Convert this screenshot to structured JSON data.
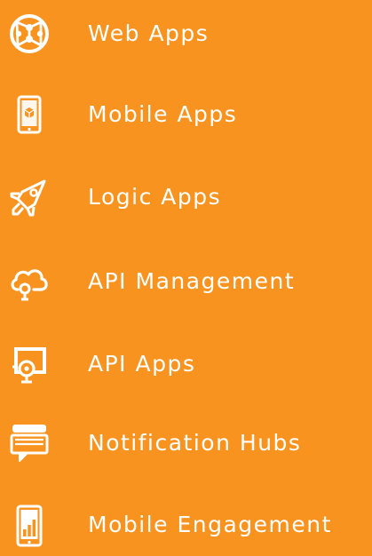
{
  "menu": {
    "background_color": "#F7931E",
    "foreground_color": "#FFFFFF",
    "items": [
      {
        "label": "Web Apps",
        "icon": "globe-network-icon"
      },
      {
        "label": "Mobile Apps",
        "icon": "mobile-device-icon"
      },
      {
        "label": "Logic Apps",
        "icon": "rocket-icon"
      },
      {
        "label": "API Management",
        "icon": "cloud-gear-icon"
      },
      {
        "label": "API Apps",
        "icon": "api-window-icon"
      },
      {
        "label": "Notification Hubs",
        "icon": "notification-stack-icon"
      },
      {
        "label": "Mobile Engagement",
        "icon": "mobile-chart-icon"
      }
    ]
  }
}
